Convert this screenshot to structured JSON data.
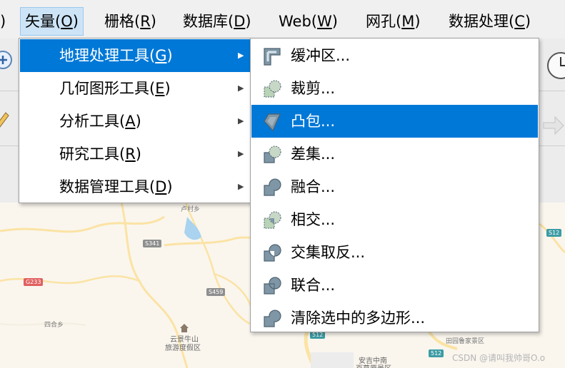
{
  "menubar": {
    "items": [
      {
        "label": ")",
        "key": ""
      },
      {
        "label": "矢量(",
        "key": "O",
        "suffix": ")"
      },
      {
        "label": "栅格(",
        "key": "R",
        "suffix": ")"
      },
      {
        "label": "数据库(",
        "key": "D",
        "suffix": ")"
      },
      {
        "label": "Web(",
        "key": "W",
        "suffix": ")"
      },
      {
        "label": "网孔(",
        "key": "M",
        "suffix": ")"
      },
      {
        "label": "数据处理(",
        "key": "C",
        "suffix": ")"
      }
    ]
  },
  "vector_menu": {
    "items": [
      {
        "label": "地理处理工具(",
        "key": "G",
        "suffix": ")"
      },
      {
        "label": "几何图形工具(",
        "key": "E",
        "suffix": ")"
      },
      {
        "label": "分析工具(",
        "key": "A",
        "suffix": ")"
      },
      {
        "label": "研究工具(",
        "key": "R",
        "suffix": ")"
      },
      {
        "label": "数据管理工具(",
        "key": "D",
        "suffix": ")"
      }
    ],
    "arrow": "▶"
  },
  "geoprocessing_menu": {
    "items": [
      {
        "label": "缓冲区...",
        "icon": "buffer-icon"
      },
      {
        "label": "裁剪...",
        "icon": "clip-icon"
      },
      {
        "label": "凸包...",
        "icon": "convex-hull-icon"
      },
      {
        "label": "差集...",
        "icon": "difference-icon"
      },
      {
        "label": "融合...",
        "icon": "dissolve-icon"
      },
      {
        "label": "相交...",
        "icon": "intersection-icon"
      },
      {
        "label": "交集取反...",
        "icon": "symmetric-difference-icon"
      },
      {
        "label": "联合...",
        "icon": "union-icon"
      },
      {
        "label": "清除选中的多边形...",
        "icon": "eliminate-polygons-icon"
      }
    ]
  },
  "map": {
    "labels": [
      "卢村乡",
      "四合乡",
      "云景牛山",
      "旅游度假区",
      "安吉中南",
      "百草原景区",
      "田园鲁家景区"
    ],
    "shields": [
      "S341",
      "G233",
      "S459",
      "512",
      "S12"
    ]
  },
  "watermark": "CSDN @请叫我帅哥O.o",
  "colors": {
    "highlight": "#0078d7",
    "active_menubar": "#cde4f7",
    "icon_fill": "#7e96a6",
    "icon_light": "#b9d3b7"
  }
}
